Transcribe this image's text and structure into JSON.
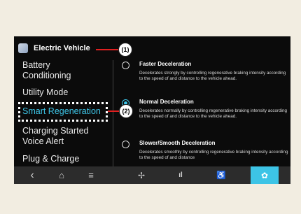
{
  "header": {
    "title": "Electric Vehicle"
  },
  "sidebar": {
    "items": [
      {
        "label": "Battery\nConditioning"
      },
      {
        "label": "Utility Mode"
      },
      {
        "label": "Smart Regeneration"
      },
      {
        "label": "Charging Started\nVoice Alert"
      },
      {
        "label": "Plug & Charge"
      }
    ]
  },
  "options": [
    {
      "title": "Faster Deceleration",
      "desc": "Decelerates strongly by controlling regenerative braking intensity according to the speed of and distance to the vehicle ahead.",
      "selected": false
    },
    {
      "title": "Normal Deceleration",
      "desc": "Decelerates normally by controlling regenerative braking intensity according to the speed of and distance to the vehicle ahead.",
      "selected": true
    },
    {
      "title": "Slower/Smooth Deceleration",
      "desc": "Decelerates smoothly by controlling regenerative braking intensity according to the speed of and distance",
      "selected": false
    }
  ],
  "callouts": {
    "one": "(1)",
    "two": "(2)"
  },
  "navbar": {
    "back": "‹",
    "home": "⌂",
    "menu": "≡",
    "fan": "✢",
    "media": "ıl",
    "seat": "♿",
    "settings": "✿"
  },
  "colors": {
    "accent": "#3dc4e6",
    "callout_line": "#e02020"
  }
}
